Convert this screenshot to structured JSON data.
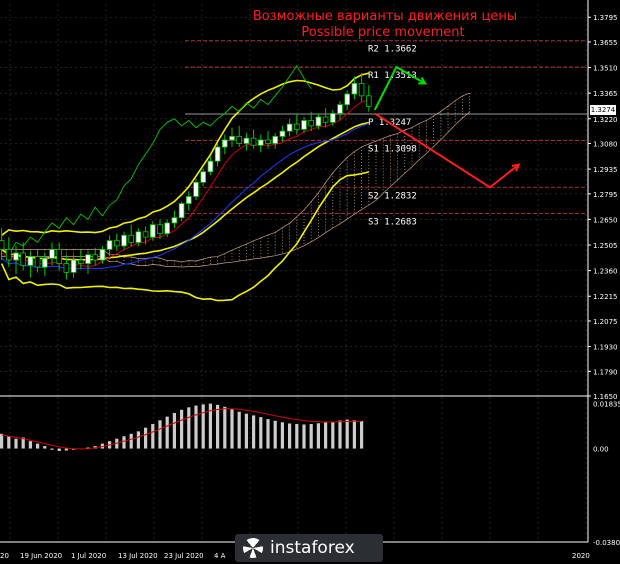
{
  "title": {
    "ru": "Возможные варианты движения цены",
    "en": "Possible price movement"
  },
  "watermark": "instaforex",
  "current_price": "1.3274",
  "chart_data": [
    {
      "type": "candlestick",
      "pair": "",
      "price_axis": [
        "1.3795",
        "1.3655",
        "1.3510",
        "1.3365",
        "1.3220",
        "1.3080",
        "1.2935",
        "1.2795",
        "1.2650",
        "1.2505",
        "1.2360",
        "1.2215",
        "1.2075",
        "1.1930",
        "1.1790",
        "1.1650"
      ],
      "ylim": [
        1.165,
        1.387
      ],
      "date_labels": [
        "20",
        "19 Jun 2020",
        "1 Jul 2020",
        "13 Jul 2020",
        "23 Jul 2020",
        "4 A",
        "2020"
      ],
      "pivot_levels": [
        {
          "name": "R2",
          "value": 1.3662,
          "label": "R2 1.3662",
          "color": "#d23c3c"
        },
        {
          "name": "R1",
          "value": 1.3513,
          "label": "R1 1.3513",
          "color": "#d23c3c"
        },
        {
          "name": "P",
          "value": 1.3247,
          "label": "P 1.3247",
          "color": "#cccccc"
        },
        {
          "name": "S1",
          "value": 1.3098,
          "label": "S1 1.3098",
          "color": "#d23c3c"
        },
        {
          "name": "S2",
          "value": 1.2832,
          "label": "S2 1.2832",
          "color": "#d23c3c"
        },
        {
          "name": "S3",
          "value": 1.2683,
          "label": "S3 1.2683",
          "color": "#d23c3c"
        }
      ],
      "candles": [
        [
          1.253,
          1.26,
          1.242,
          1.248
        ],
        [
          1.248,
          1.255,
          1.238,
          1.242
        ],
        [
          1.242,
          1.25,
          1.234,
          1.246
        ],
        [
          1.246,
          1.252,
          1.236,
          1.239
        ],
        [
          1.239,
          1.247,
          1.232,
          1.244
        ],
        [
          1.244,
          1.248,
          1.235,
          1.238
        ],
        [
          1.238,
          1.246,
          1.233,
          1.243
        ],
        [
          1.243,
          1.252,
          1.239,
          1.248
        ],
        [
          1.248,
          1.252,
          1.236,
          1.24
        ],
        [
          1.24,
          1.245,
          1.231,
          1.235
        ],
        [
          1.235,
          1.245,
          1.232,
          1.242
        ],
        [
          1.242,
          1.248,
          1.237,
          1.24
        ],
        [
          1.24,
          1.247,
          1.234,
          1.245
        ],
        [
          1.245,
          1.249,
          1.239,
          1.242
        ],
        [
          1.242,
          1.25,
          1.24,
          1.248
        ],
        [
          1.248,
          1.256,
          1.245,
          1.253
        ],
        [
          1.253,
          1.257,
          1.247,
          1.25
        ],
        [
          1.25,
          1.258,
          1.248,
          1.256
        ],
        [
          1.256,
          1.262,
          1.25,
          1.252
        ],
        [
          1.252,
          1.26,
          1.25,
          1.258
        ],
        [
          1.258,
          1.261,
          1.251,
          1.255
        ],
        [
          1.255,
          1.264,
          1.253,
          1.262
        ],
        [
          1.262,
          1.265,
          1.254,
          1.257
        ],
        [
          1.257,
          1.265,
          1.255,
          1.263
        ],
        [
          1.263,
          1.27,
          1.26,
          1.266
        ],
        [
          1.266,
          1.275,
          1.264,
          1.274
        ],
        [
          1.274,
          1.281,
          1.27,
          1.278
        ],
        [
          1.278,
          1.288,
          1.276,
          1.286
        ],
        [
          1.286,
          1.294,
          1.284,
          1.292
        ],
        [
          1.292,
          1.301,
          1.29,
          1.298
        ],
        [
          1.298,
          1.308,
          1.295,
          1.306
        ],
        [
          1.306,
          1.313,
          1.302,
          1.31
        ],
        [
          1.31,
          1.317,
          1.306,
          1.312
        ],
        [
          1.312,
          1.318,
          1.306,
          1.308
        ],
        [
          1.308,
          1.314,
          1.304,
          1.311
        ],
        [
          1.311,
          1.316,
          1.305,
          1.307
        ],
        [
          1.307,
          1.313,
          1.303,
          1.31
        ],
        [
          1.31,
          1.315,
          1.305,
          1.308
        ],
        [
          1.308,
          1.314,
          1.305,
          1.312
        ],
        [
          1.312,
          1.318,
          1.309,
          1.315
        ],
        [
          1.315,
          1.322,
          1.312,
          1.319
        ],
        [
          1.319,
          1.325,
          1.313,
          1.316
        ],
        [
          1.316,
          1.323,
          1.314,
          1.321
        ],
        [
          1.321,
          1.326,
          1.315,
          1.318
        ],
        [
          1.318,
          1.325,
          1.316,
          1.323
        ],
        [
          1.323,
          1.328,
          1.317,
          1.32
        ],
        [
          1.32,
          1.327,
          1.318,
          1.325
        ],
        [
          1.325,
          1.332,
          1.321,
          1.33
        ],
        [
          1.33,
          1.338,
          1.327,
          1.336
        ],
        [
          1.336,
          1.346,
          1.333,
          1.342
        ],
        [
          1.342,
          1.348,
          1.332,
          1.335
        ],
        [
          1.335,
          1.341,
          1.326,
          1.329
        ]
      ],
      "scenario_up": [
        [
          1.327,
          0
        ],
        [
          1.3513,
          3
        ],
        [
          1.342,
          7
        ]
      ],
      "scenario_down": [
        [
          1.325,
          0
        ],
        [
          1.2832,
          16
        ],
        [
          1.296,
          20
        ]
      ],
      "oscillator": {
        "axis": [
          "0.01835",
          "0.00",
          "-0.03807"
        ],
        "ylim": [
          -0.03807,
          0.021
        ],
        "bars": [
          0.006,
          0.005,
          0.004,
          0.0045,
          0.003,
          0.002,
          0.001,
          -0.0005,
          -0.001,
          -0.0008,
          -0.0005,
          -0.0002,
          0.0004,
          0.001,
          0.002,
          0.003,
          0.004,
          0.005,
          0.006,
          0.007,
          0.0085,
          0.01,
          0.0115,
          0.013,
          0.0145,
          0.0158,
          0.0168,
          0.0175,
          0.018,
          0.0183,
          0.0178,
          0.017,
          0.016,
          0.015,
          0.0142,
          0.0135,
          0.0128,
          0.012,
          0.0113,
          0.0107,
          0.0102,
          0.01,
          0.0098,
          0.01,
          0.0103,
          0.0107,
          0.011,
          0.0114,
          0.0118,
          0.0115,
          0.0112
        ],
        "signal": [
          0.0055,
          0.005,
          0.0045,
          0.004,
          0.0033,
          0.0027,
          0.002,
          0.0013,
          0.0007,
          0.0002,
          -0.0001,
          -0.0002,
          -0.0001,
          0.0003,
          0.0008,
          0.0015,
          0.0022,
          0.003,
          0.0038,
          0.0047,
          0.0057,
          0.0068,
          0.008,
          0.0092,
          0.0104,
          0.0116,
          0.0127,
          0.0137,
          0.0146,
          0.0154,
          0.0159,
          0.0162,
          0.0162,
          0.016,
          0.0156,
          0.0151,
          0.0146,
          0.014,
          0.0134,
          0.0128,
          0.0123,
          0.0118,
          0.0114,
          0.0111,
          0.0109,
          0.0108,
          0.0108,
          0.0109,
          0.011,
          0.0111,
          0.0111
        ]
      },
      "colors": {
        "bull_candle": "#00c800",
        "bear_candle": "#00c800",
        "bollinger": "#f0f000",
        "ema_fast": "#d20000",
        "ema_slow": "#1e3cff",
        "chikou": "#00c800",
        "cloud": "#c8a082",
        "pivot": "#d23c3c",
        "arrow_up": "#00e000",
        "arrow_down": "#ff1e1e",
        "osc_bars": "#cccccc",
        "osc_signal": "#d20000",
        "grid": "#3a3a3a"
      }
    }
  ]
}
